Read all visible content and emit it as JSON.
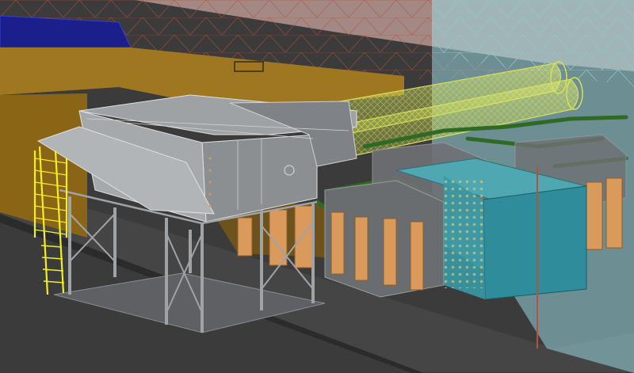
{
  "viewport": {
    "view_type": "3D model viewport (no visible UI text)",
    "background": "#3b3b3b"
  },
  "colors": {
    "floor_dark": "#3a3a3a",
    "slab_mid": "#4a4a4a",
    "building_wall_orange": "#8a6516",
    "building_roof_orange": "#a37a1f",
    "blue_block": "#1a1f8c",
    "steel_grey": "#a0a3a6",
    "steel_dark": "#7b7e82",
    "ladder_yellow": "#f1ee23",
    "duct_yellow_green": "#d7e15a",
    "pipe_green": "#2f6a24",
    "copper_panel": "#d99a5c",
    "transformer_teal": "#2f8c9a",
    "glass_cyan": "#9fe2ea",
    "roof_grid_red": "#b0533f",
    "wall_glass_pink": "#c7a39c"
  },
  "icons": {
    "viewport": "cad-3d-scene",
    "ladder": "ladder-icon",
    "duct": "duct-icon",
    "fan_unit": "ventilation-unit-icon"
  }
}
